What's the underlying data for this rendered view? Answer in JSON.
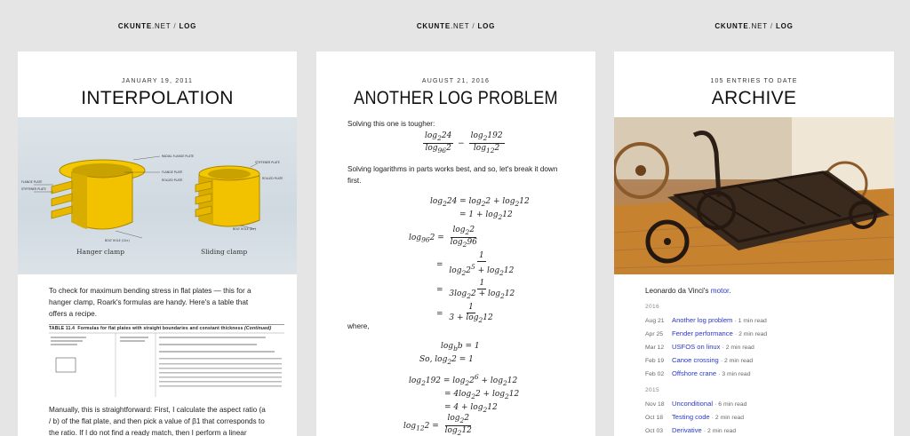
{
  "site": {
    "name": "CKUNTE",
    "tld": ".NET",
    "sep": "/",
    "section": "LOG"
  },
  "cards": {
    "interpolation": {
      "date": "JANUARY 19, 2011",
      "title": "INTERPOLATION",
      "figure": {
        "caption_left": "Hanger clamp",
        "caption_right": "Sliding clamp",
        "labels": [
          "RADIAL FLANGE PLATE",
          "FLANGE PLATE",
          "STIFFENER PLATE",
          "ROLLED PLATE",
          "BOLT HOLE (10×)",
          "STIFFENER PLATE",
          "ROLLED PLATE",
          "BOLT HOLE (8×)"
        ]
      },
      "para1": "To check for maximum bending stress in flat plates — this for a hanger clamp, Roark's formulas are handy. Here's a table that offers a recipe.",
      "table_title": "TABLE 11.4",
      "table_heading": "Formulas for flat plates with straight boundaries and constant thickness",
      "table_heading_cont": "(Continued)",
      "para2": "Manually, this is straightforward: First, I calculate the aspect ratio (a / b) of the flat plate, and then pick a value of β1 that corresponds to the ratio. If I do not find a ready match, then I perform a linear"
    },
    "log_problem": {
      "date": "AUGUST 21, 2016",
      "title": "ANOTHER LOG PROBLEM",
      "intro": "Solving this one is tougher:",
      "para": "Solving logarithms in parts works best, and so, let's break it down first.",
      "where": "where,"
    },
    "archive": {
      "count_line": "105 ENTRIES TO DATE",
      "title": "ARCHIVE",
      "caption_text": "Leonardo da Vinci's ",
      "caption_link": "motor",
      "caption_end": ".",
      "years": [
        {
          "year": "2016",
          "entries": [
            {
              "date": "Aug 21",
              "title": "Another log problem",
              "meta": "· 1 min read"
            },
            {
              "date": "Apr 25",
              "title": "Fender performance",
              "meta": "· 2 min read"
            },
            {
              "date": "Mar 12",
              "title": "USFOS on linux",
              "meta": "· 2 min read"
            },
            {
              "date": "Feb 19",
              "title": "Canoe crossing",
              "meta": "· 2 min read"
            },
            {
              "date": "Feb 02",
              "title": "Offshore crane",
              "meta": "· 3 min read"
            }
          ]
        },
        {
          "year": "2015",
          "entries": [
            {
              "date": "Nov 18",
              "title": "Unconditional",
              "meta": "· 6 min read"
            },
            {
              "date": "Oct 18",
              "title": "Testing code",
              "meta": "· 2 min read"
            },
            {
              "date": "Oct 03",
              "title": "Derivative",
              "meta": "· 2 min read"
            }
          ]
        }
      ]
    }
  },
  "colors": {
    "link": "#2a39c8",
    "clamp": "#f2c200",
    "background": "#e5e5e5"
  }
}
